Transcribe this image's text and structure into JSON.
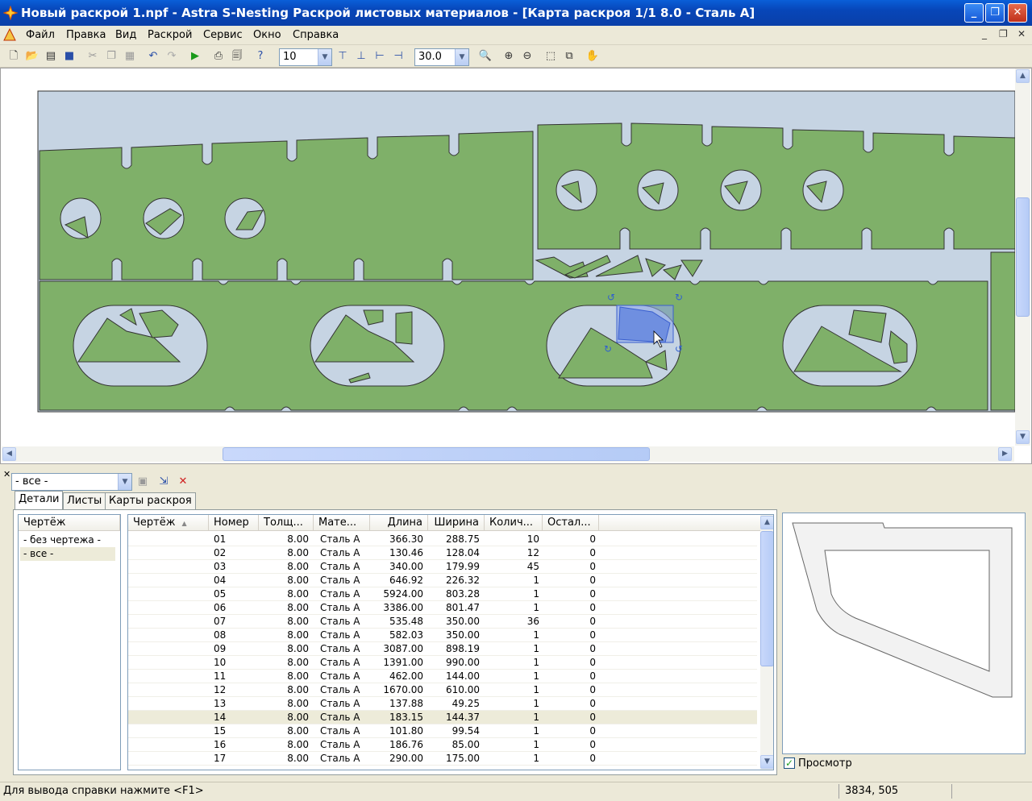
{
  "window": {
    "title": "Новый раскрой 1.npf - Astra S-Nesting Раскрой листовых материалов - [Карта раскроя 1/1 8.0 - Сталь А]",
    "minimize": "_",
    "maximize": "❐",
    "close": "✕"
  },
  "menu": {
    "items": [
      "Файл",
      "Правка",
      "Вид",
      "Раскрой",
      "Сервис",
      "Окно",
      "Справка"
    ],
    "mdi_min": "_",
    "mdi_restore": "❐",
    "mdi_close": "✕"
  },
  "toolbar": {
    "grid_step": "10",
    "zoom_value": "30.0"
  },
  "bottom_panel": {
    "filter_value": "- все -",
    "tabs": [
      "Детали",
      "Листы",
      "Карты раскроя"
    ],
    "drawings_header": "Чертёж",
    "drawings": [
      "- без чертежа -",
      "- все -"
    ],
    "columns": [
      "Чертёж",
      "Номер",
      "Толщ...",
      "Мате...",
      "Длина",
      "Ширина",
      "Колич...",
      "Остал..."
    ],
    "rows": [
      {
        "num": "01",
        "thick": "8.00",
        "mat": "Сталь А",
        "len": "366.30",
        "wid": "288.75",
        "qty": "10",
        "rem": "0"
      },
      {
        "num": "02",
        "thick": "8.00",
        "mat": "Сталь А",
        "len": "130.46",
        "wid": "128.04",
        "qty": "12",
        "rem": "0"
      },
      {
        "num": "03",
        "thick": "8.00",
        "mat": "Сталь А",
        "len": "340.00",
        "wid": "179.99",
        "qty": "45",
        "rem": "0"
      },
      {
        "num": "04",
        "thick": "8.00",
        "mat": "Сталь А",
        "len": "646.92",
        "wid": "226.32",
        "qty": "1",
        "rem": "0"
      },
      {
        "num": "05",
        "thick": "8.00",
        "mat": "Сталь А",
        "len": "5924.00",
        "wid": "803.28",
        "qty": "1",
        "rem": "0"
      },
      {
        "num": "06",
        "thick": "8.00",
        "mat": "Сталь А",
        "len": "3386.00",
        "wid": "801.47",
        "qty": "1",
        "rem": "0"
      },
      {
        "num": "07",
        "thick": "8.00",
        "mat": "Сталь А",
        "len": "535.48",
        "wid": "350.00",
        "qty": "36",
        "rem": "0"
      },
      {
        "num": "08",
        "thick": "8.00",
        "mat": "Сталь А",
        "len": "582.03",
        "wid": "350.00",
        "qty": "1",
        "rem": "0"
      },
      {
        "num": "09",
        "thick": "8.00",
        "mat": "Сталь А",
        "len": "3087.00",
        "wid": "898.19",
        "qty": "1",
        "rem": "0"
      },
      {
        "num": "10",
        "thick": "8.00",
        "mat": "Сталь А",
        "len": "1391.00",
        "wid": "990.00",
        "qty": "1",
        "rem": "0"
      },
      {
        "num": "11",
        "thick": "8.00",
        "mat": "Сталь А",
        "len": "462.00",
        "wid": "144.00",
        "qty": "1",
        "rem": "0"
      },
      {
        "num": "12",
        "thick": "8.00",
        "mat": "Сталь А",
        "len": "1670.00",
        "wid": "610.00",
        "qty": "1",
        "rem": "0"
      },
      {
        "num": "13",
        "thick": "8.00",
        "mat": "Сталь А",
        "len": "137.88",
        "wid": "49.25",
        "qty": "1",
        "rem": "0"
      },
      {
        "num": "14",
        "thick": "8.00",
        "mat": "Сталь А",
        "len": "183.15",
        "wid": "144.37",
        "qty": "1",
        "rem": "0"
      },
      {
        "num": "15",
        "thick": "8.00",
        "mat": "Сталь А",
        "len": "101.80",
        "wid": "99.54",
        "qty": "1",
        "rem": "0"
      },
      {
        "num": "16",
        "thick": "8.00",
        "mat": "Сталь А",
        "len": "186.76",
        "wid": "85.00",
        "qty": "1",
        "rem": "0"
      },
      {
        "num": "17",
        "thick": "8.00",
        "mat": "Сталь А",
        "len": "290.00",
        "wid": "175.00",
        "qty": "1",
        "rem": "0"
      }
    ],
    "selected_row": "14",
    "preview_label": "Просмотр",
    "preview_checked": true
  },
  "status": {
    "help_text": "Для вывода справки нажмите <F1>",
    "coords": "3834, 505"
  },
  "colors": {
    "part_fill": "#7fb069",
    "sheet_fill": "#c6d4e3",
    "selected_part": "#6f8fe0"
  }
}
